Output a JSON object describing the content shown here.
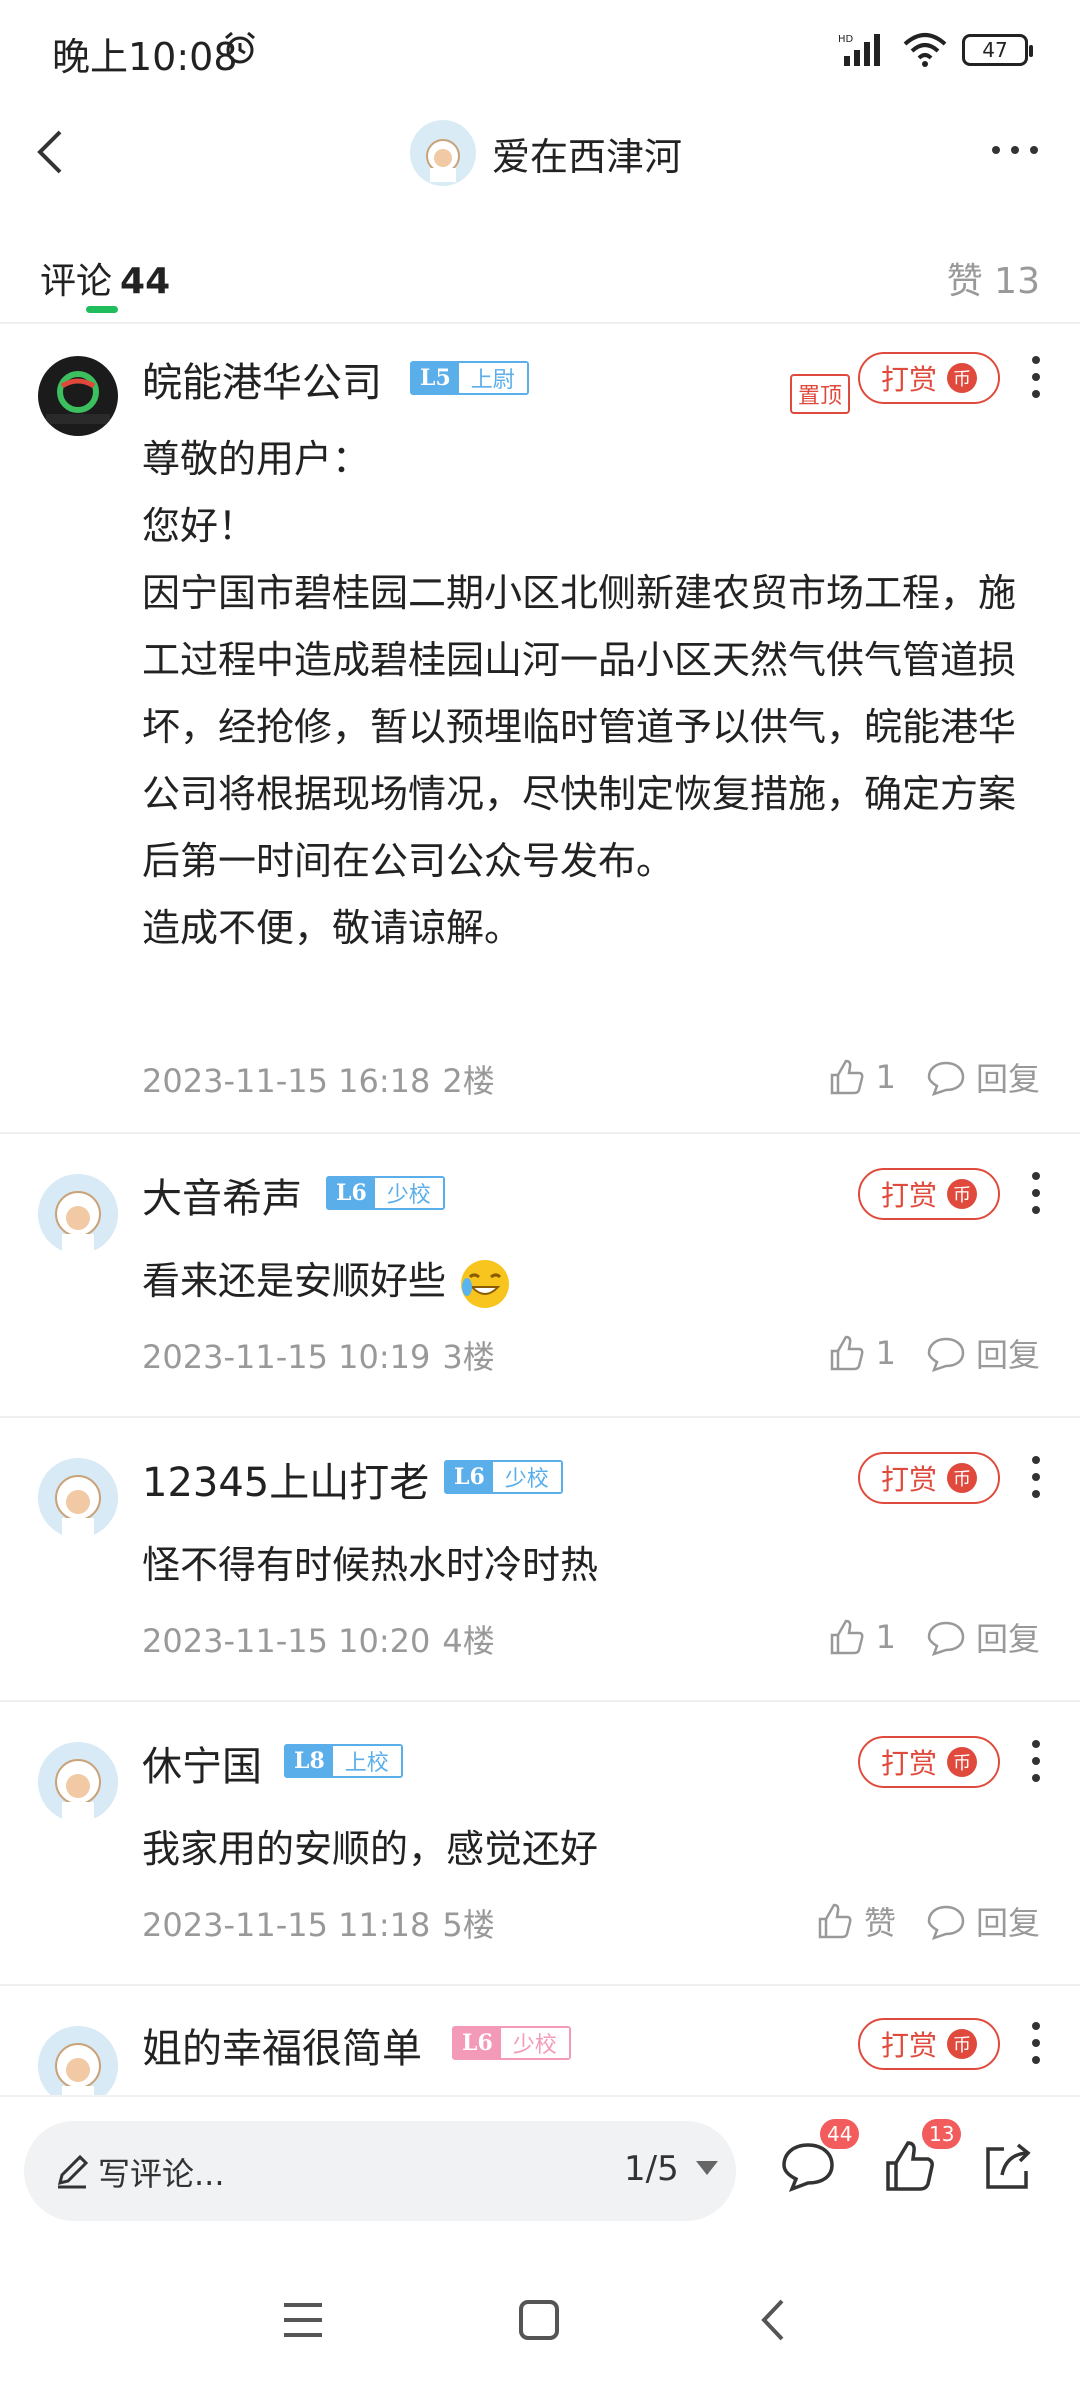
{
  "status_bar": {
    "time": "晚上10:08",
    "battery": "47",
    "network_label": "HD"
  },
  "header": {
    "title": "爱在西津河"
  },
  "tabs": {
    "comments_label": "评论",
    "comments_count": "44",
    "likes_label": "赞 13"
  },
  "comments": [
    {
      "user": "皖能港华公司",
      "level": "L5",
      "rank": "上尉",
      "badge_color": "#5aaee9",
      "pinned": "置顶",
      "tip_label": "打赏",
      "tip_coin": "币",
      "lines": [
        "尊敬的用户：",
        "您好！",
        "因宁国市碧桂园二期小区北侧新建农贸市场工程，施工过程中造成碧桂园山河一品小区天然气供气管道损坏，经抢修，暂以预埋临时管道予以供气，皖能港华公司将根据现场情况，尽快制定恢复措施，确定方案后第一时间在公司公众号发布。",
        "造成不便，敬请谅解。"
      ],
      "time": "2023-11-15 16:18",
      "floor": "2楼",
      "likes": "1",
      "reply": "回复"
    },
    {
      "user": "大音希声",
      "level": "L6",
      "rank": "少校",
      "badge_color": "#5aaee9",
      "tip_label": "打赏",
      "tip_coin": "币",
      "text": "看来还是安顺好些",
      "time": "2023-11-15 10:19",
      "floor": "3楼",
      "likes": "1",
      "reply": "回复"
    },
    {
      "user": "12345上山打老",
      "level": "L6",
      "rank": "少校",
      "badge_color": "#5aaee9",
      "tip_label": "打赏",
      "tip_coin": "币",
      "text": "怪不得有时候热水时冷时热",
      "time": "2023-11-15 10:20",
      "floor": "4楼",
      "likes": "1",
      "reply": "回复"
    },
    {
      "user": "休宁国",
      "level": "L8",
      "rank": "上校",
      "badge_color": "#5aaee9",
      "tip_label": "打赏",
      "tip_coin": "币",
      "text": "我家用的安顺的，感觉还好",
      "time": "2023-11-15 11:18",
      "floor": "5楼",
      "likes": "赞",
      "reply": "回复"
    },
    {
      "user": "姐的幸福很简单",
      "level": "L6",
      "rank": "少校",
      "badge_color": "#f39ab9",
      "tip_label": "打赏",
      "tip_coin": "币"
    }
  ],
  "bottom_bar": {
    "input_placeholder": "写评论...",
    "page": "1/5",
    "comment_badge": "44",
    "like_badge": "13"
  },
  "icons": [
    "back-icon",
    "more-icon",
    "alarm-icon",
    "signal-icon",
    "wifi-icon",
    "battery-icon",
    "thumbs-up-icon",
    "reply-bubble-icon",
    "pen-icon",
    "comment-icon",
    "like-icon",
    "share-icon",
    "menu-icon",
    "home-icon",
    "nav-back-icon"
  ]
}
